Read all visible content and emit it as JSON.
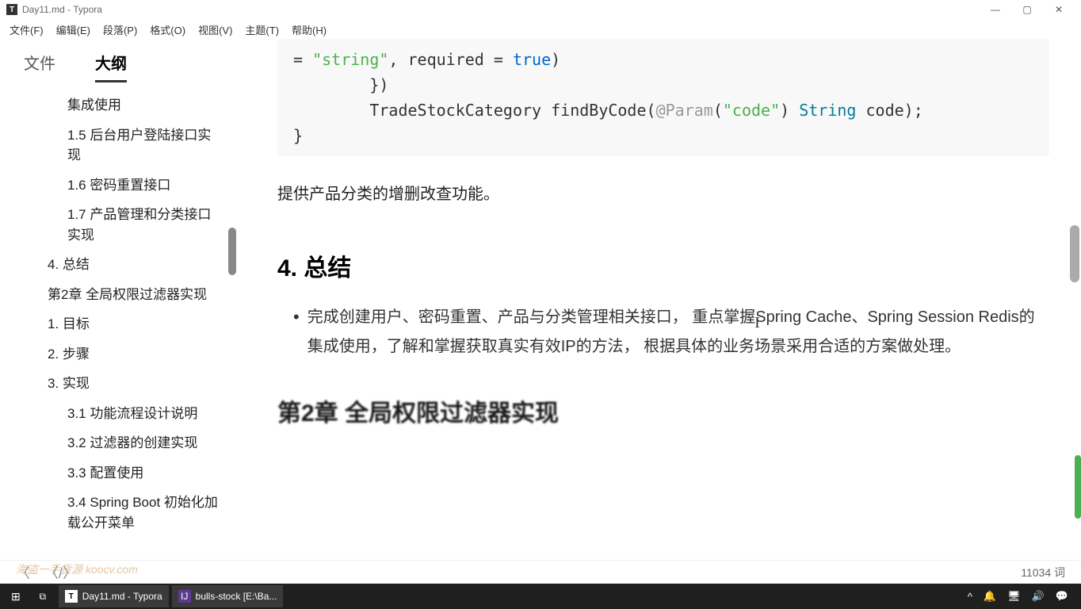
{
  "window": {
    "title": "Day11.md - Typora",
    "icon": "T"
  },
  "menu": {
    "items": [
      "文件(F)",
      "编辑(E)",
      "段落(P)",
      "格式(O)",
      "视图(V)",
      "主题(T)",
      "帮助(H)"
    ]
  },
  "sidebar": {
    "tabs": {
      "files": "文件",
      "outline": "大纲"
    },
    "activeTab": "outline",
    "outline": [
      {
        "level": "l2",
        "text": "集成使用"
      },
      {
        "level": "l2",
        "text": "1.5 后台用户登陆接口实现"
      },
      {
        "level": "l2",
        "text": "1.6 密码重置接口"
      },
      {
        "level": "l2",
        "text": "1.7 产品管理和分类接口实现"
      },
      {
        "level": "l1",
        "text": "4. 总结"
      },
      {
        "level": "l1",
        "text": "第2章 全局权限过滤器实现"
      },
      {
        "level": "l1",
        "text": "1. 目标"
      },
      {
        "level": "l1",
        "text": "2. 步骤"
      },
      {
        "level": "l1",
        "text": "3. 实现"
      },
      {
        "level": "l2",
        "text": "3.1 功能流程设计说明"
      },
      {
        "level": "l2",
        "text": "3.2 过滤器的创建实现"
      },
      {
        "level": "l2",
        "text": "3.3 配置使用"
      },
      {
        "level": "l2",
        "text": "3.4 Spring Boot 初始化加载公开菜单"
      }
    ]
  },
  "editor": {
    "code": {
      "line1_eq": "= ",
      "line1_str": "\"string\"",
      "line1_mid": ", required = ",
      "line1_true": "true",
      "line1_end": ")",
      "line2": "        })",
      "line3_pre": "        TradeStockCategory findByCode(",
      "line3_ann": "@Param",
      "line3_open": "(",
      "line3_str": "\"code\"",
      "line3_close": ") ",
      "line3_type": "String",
      "line3_end": " code);",
      "line4": "}"
    },
    "para1": "提供产品分类的增删改查功能。",
    "h2_summary": "4. 总结",
    "bullet1": "完成创建用户、密码重置、产品与分类管理相关接口， 重点掌握Spring Cache、Spring Session Redis的集成使用，了解和掌握获取真实有效IP的方法， 根据具体的业务场景采用合适的方案做处理。",
    "h2_partial": "第2章 全局权限过滤器实现"
  },
  "status": {
    "wordcount": "11034 词"
  },
  "taskbar": {
    "typora": "Day11.md - Typora",
    "idea": "bulls-stock [E:\\Ba..."
  },
  "watermark": "海盗一手货源 koocv.com"
}
